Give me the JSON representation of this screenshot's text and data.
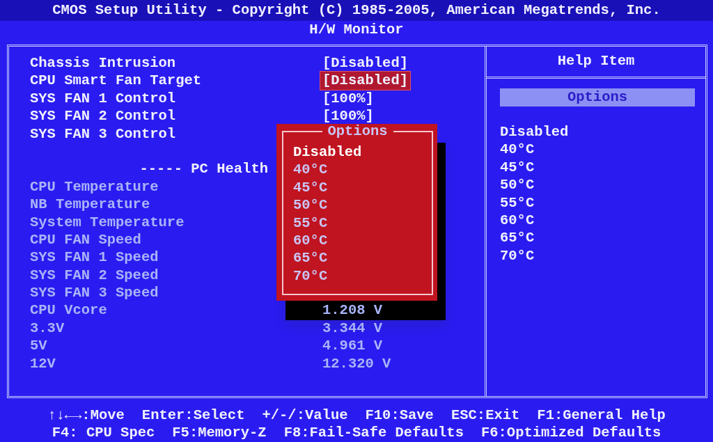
{
  "header": {
    "title": "CMOS Setup Utility - Copyright (C) 1985-2005, American Megatrends, Inc.",
    "subtitle": "H/W Monitor"
  },
  "items": [
    {
      "kind": "setting",
      "label": "Chassis Intrusion",
      "value": "[Disabled]",
      "selected": false
    },
    {
      "kind": "setting",
      "label": "CPU Smart Fan Target",
      "value": "[Disabled]",
      "selected": true
    },
    {
      "kind": "setting",
      "label": "SYS FAN 1 Control",
      "value": "[100%]",
      "selected": false
    },
    {
      "kind": "setting",
      "label": "SYS FAN 2 Control",
      "value": "[100%]",
      "selected": false
    },
    {
      "kind": "setting",
      "label": "SYS FAN 3 Control",
      "selected": false
    },
    {
      "kind": "spacer"
    },
    {
      "kind": "header",
      "label": "----- PC Health"
    },
    {
      "kind": "reading",
      "label": "CPU Temperature"
    },
    {
      "kind": "reading",
      "label": "NB Temperature"
    },
    {
      "kind": "reading",
      "label": "System Temperature"
    },
    {
      "kind": "reading",
      "label": "CPU FAN Speed"
    },
    {
      "kind": "reading",
      "label": "SYS FAN 1 Speed"
    },
    {
      "kind": "reading",
      "label": "SYS FAN 2 Speed"
    },
    {
      "kind": "reading",
      "label": "SYS FAN 3 Speed"
    },
    {
      "kind": "reading",
      "label": "CPU Vcore",
      "value": "1.208 V"
    },
    {
      "kind": "reading",
      "label": "3.3V",
      "value": "3.344 V"
    },
    {
      "kind": "reading",
      "label": "5V",
      "value": "4.961 V"
    },
    {
      "kind": "reading",
      "label": "12V",
      "value": "12.320 V"
    }
  ],
  "popup": {
    "title": "Options",
    "options": [
      {
        "label": "Disabled",
        "selected": true
      },
      {
        "label": "40°C",
        "selected": false
      },
      {
        "label": "45°C",
        "selected": false
      },
      {
        "label": "50°C",
        "selected": false
      },
      {
        "label": "55°C",
        "selected": false
      },
      {
        "label": "60°C",
        "selected": false
      },
      {
        "label": "65°C",
        "selected": false
      },
      {
        "label": "70°C",
        "selected": false
      }
    ]
  },
  "help": {
    "title": "Help Item",
    "section": "Options",
    "lines": [
      "Disabled",
      "40°C",
      "45°C",
      "50°C",
      "55°C",
      "60°C",
      "65°C",
      "70°C"
    ]
  },
  "footer": [
    [
      "↑↓←→:Move",
      "Enter:Select",
      "+/-/:Value",
      "F10:Save",
      "ESC:Exit",
      "F1:General Help"
    ],
    [
      "F4: CPU Spec",
      "F5:Memory-Z",
      "F8:Fail-Safe Defaults",
      "F6:Optimized Defaults"
    ]
  ]
}
